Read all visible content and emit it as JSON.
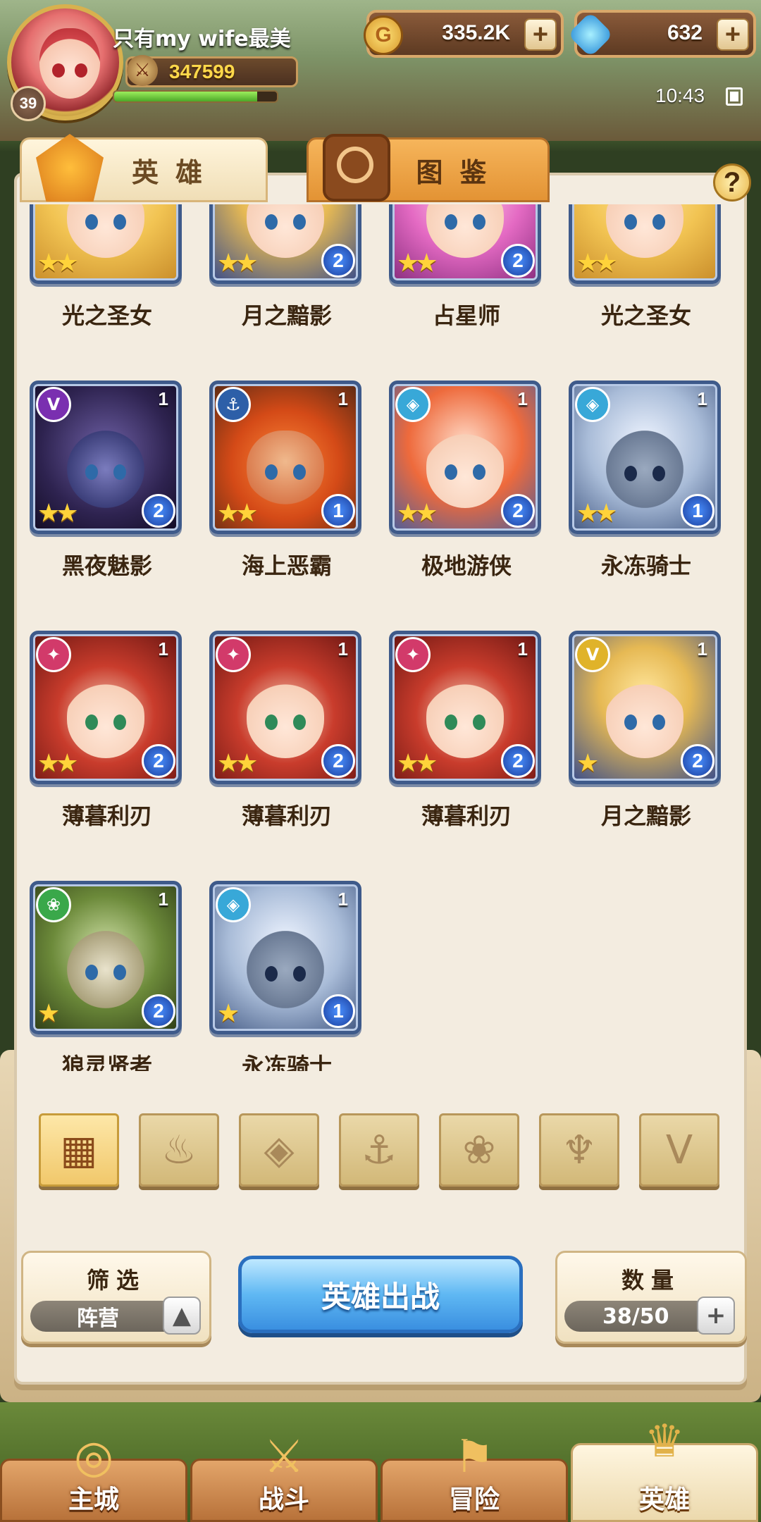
{
  "player": {
    "name": "只有my wife最美",
    "level": "39",
    "power": "347599",
    "exp_fraction": 0.88
  },
  "currency": {
    "gold": "335.2K",
    "gems": "632"
  },
  "status": {
    "time": "10:43"
  },
  "tabs": {
    "heroes": "英雄",
    "codex": "图鉴"
  },
  "heroes": [
    {
      "name": "光之圣女",
      "stars": "★★",
      "faction_glyph": "",
      "count": "",
      "rank": "",
      "style": "c-gold",
      "faction_class": ""
    },
    {
      "name": "月之黯影",
      "stars": "★★",
      "faction_glyph": "",
      "count": "",
      "rank": "2",
      "style": "c-blue",
      "faction_class": ""
    },
    {
      "name": "占星师",
      "stars": "★★",
      "faction_glyph": "",
      "count": "",
      "rank": "2",
      "style": "c-pink",
      "faction_class": ""
    },
    {
      "name": "光之圣女",
      "stars": "★★",
      "faction_glyph": "",
      "count": "",
      "rank": "",
      "style": "c-gold",
      "faction_class": ""
    },
    {
      "name": "黑夜魅影",
      "stars": "★★",
      "faction_glyph": "V",
      "count": "1",
      "rank": "2",
      "style": "c-dark",
      "faction_class": "f-dark"
    },
    {
      "name": "海上恶霸",
      "stars": "★★",
      "faction_glyph": "⚓",
      "count": "1",
      "rank": "1",
      "style": "c-pirate",
      "faction_class": "f-sea"
    },
    {
      "name": "极地游侠",
      "stars": "★★",
      "faction_glyph": "◈",
      "count": "1",
      "rank": "2",
      "style": "c-ranger",
      "faction_class": "f-ice"
    },
    {
      "name": "永冻骑士",
      "stars": "★★",
      "faction_glyph": "◈",
      "count": "1",
      "rank": "1",
      "style": "c-knight",
      "faction_class": "f-ice"
    },
    {
      "name": "薄暮利刃",
      "stars": "★★",
      "faction_glyph": "✦",
      "count": "1",
      "rank": "2",
      "style": "c-blade",
      "faction_class": "f-fire"
    },
    {
      "name": "薄暮利刃",
      "stars": "★★",
      "faction_glyph": "✦",
      "count": "1",
      "rank": "2",
      "style": "c-blade",
      "faction_class": "f-fire"
    },
    {
      "name": "薄暮利刃",
      "stars": "★★",
      "faction_glyph": "✦",
      "count": "1",
      "rank": "2",
      "style": "c-blade",
      "faction_class": "f-fire"
    },
    {
      "name": "月之黯影",
      "stars": "★",
      "faction_glyph": "V",
      "count": "1",
      "rank": "2",
      "style": "c-blue",
      "faction_class": "f-light"
    },
    {
      "name": "狼灵贤者",
      "stars": "★",
      "faction_glyph": "❀",
      "count": "1",
      "rank": "2",
      "style": "c-owl",
      "faction_class": "f-nature"
    },
    {
      "name": "永冻骑士",
      "stars": "★",
      "faction_glyph": "◈",
      "count": "1",
      "rank": "1",
      "style": "c-knight",
      "faction_class": "f-ice"
    }
  ],
  "filters": [
    {
      "icon": "grid-icon",
      "glyph": "▦",
      "active": true
    },
    {
      "icon": "fire-faction-icon",
      "glyph": "♨",
      "active": false
    },
    {
      "icon": "ice-faction-icon",
      "glyph": "◈",
      "active": false
    },
    {
      "icon": "anchor-faction-icon",
      "glyph": "⚓",
      "active": false
    },
    {
      "icon": "nature-faction-icon",
      "glyph": "❀",
      "active": false
    },
    {
      "icon": "dark-faction-icon",
      "glyph": "♆",
      "active": false
    },
    {
      "icon": "light-faction-icon",
      "glyph": "V",
      "active": false
    }
  ],
  "controls": {
    "filter_label": "筛选",
    "filter_value": "阵营",
    "deploy_label": "英雄出战",
    "count_label": "数量",
    "count_value": "38/50"
  },
  "nav": [
    {
      "label": "主城",
      "icon": "castle-icon",
      "glyph": "◎",
      "active": false
    },
    {
      "label": "战斗",
      "icon": "crossed-swords-icon",
      "glyph": "⚔",
      "active": false
    },
    {
      "label": "冒险",
      "icon": "map-scroll-icon",
      "glyph": "⚑",
      "active": false
    },
    {
      "label": "英雄",
      "icon": "helmet-icon",
      "glyph": "♛",
      "active": true
    }
  ]
}
